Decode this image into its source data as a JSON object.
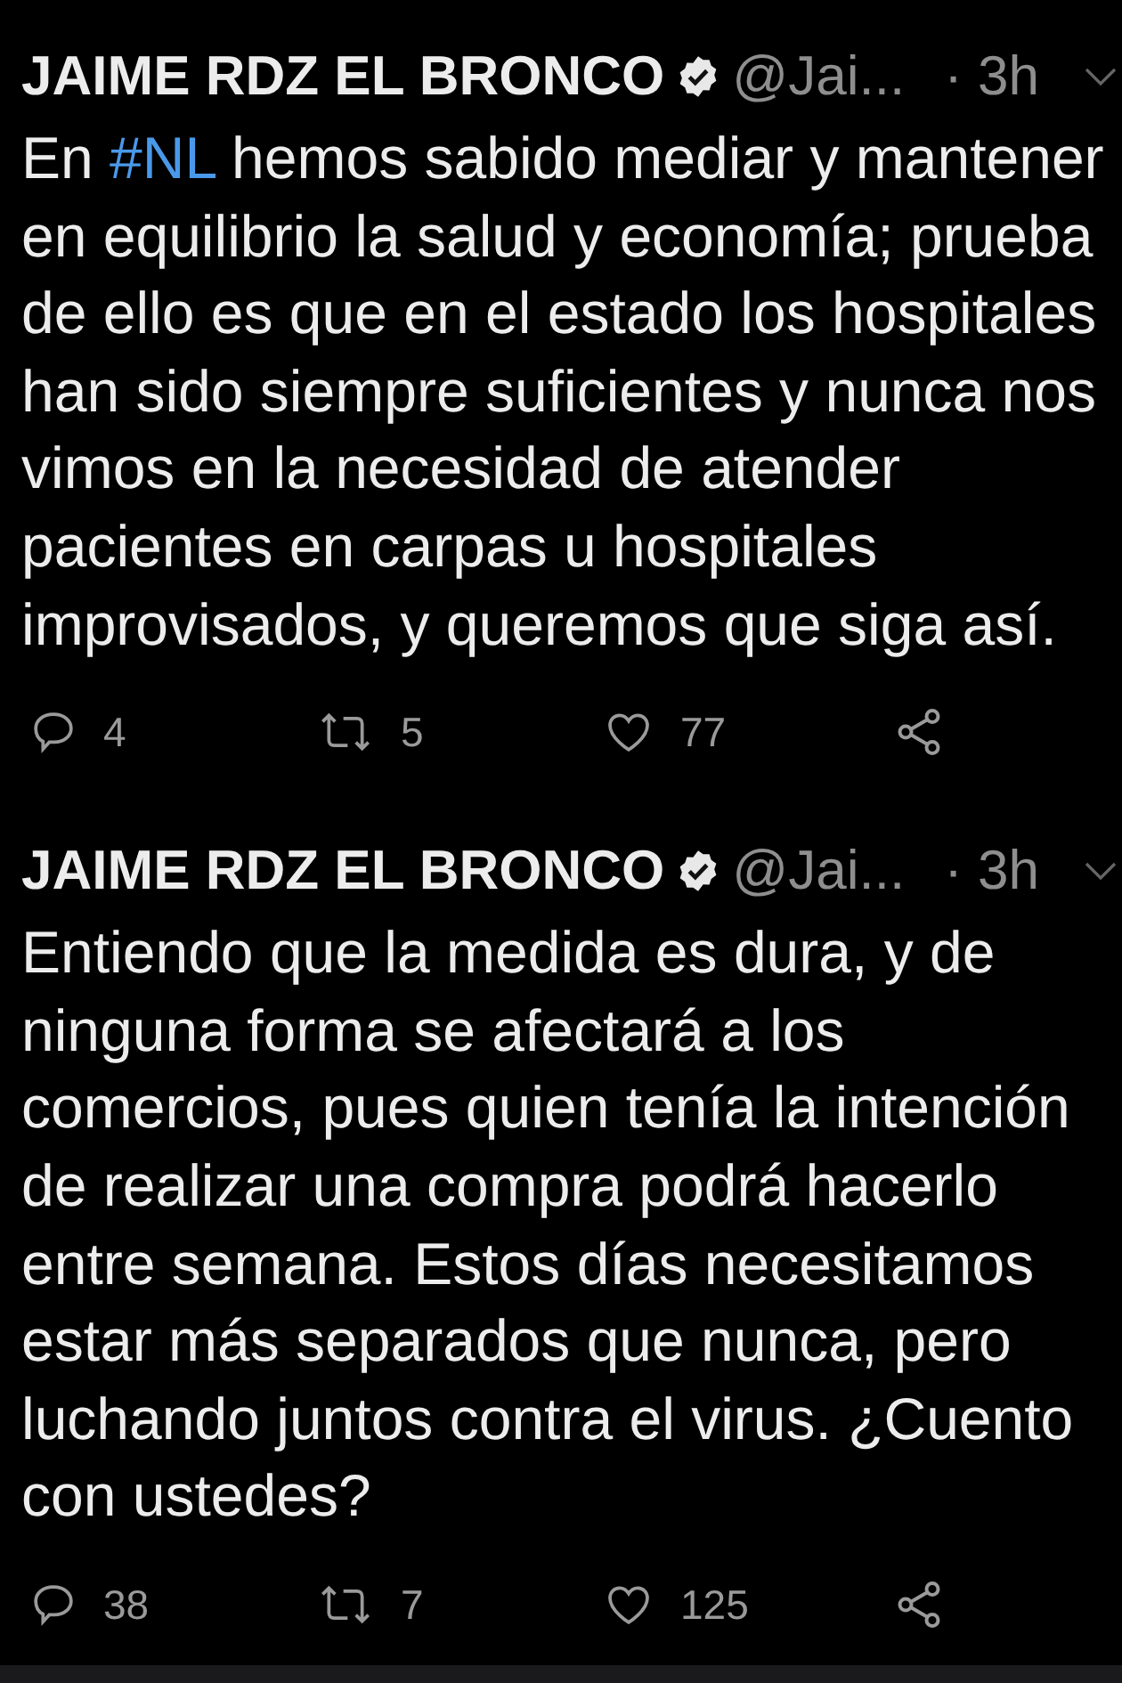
{
  "tweets": [
    {
      "name": "JAIME RDZ EL BRONCO",
      "verified": true,
      "handle": "@Jai...",
      "time": "· 3h",
      "body": [
        {
          "kind": "text",
          "text": "En "
        },
        {
          "kind": "hashtag",
          "text": "#NL"
        },
        {
          "kind": "text",
          "text": " hemos sabido mediar y mantener\nen equilibrio la salud y economía; prueba\nde ello es que en el estado los hospitales\nhan sido siempre suficientes y nunca nos\nvimos en la necesidad de atender\npacientes en carpas u hospitales\nimprovisados, y queremos que siga así."
        }
      ],
      "replies": "4",
      "retweets": "5",
      "likes": "77"
    },
    {
      "name": "JAIME RDZ EL BRONCO",
      "verified": true,
      "handle": "@Jai...",
      "time": "· 3h",
      "body": [
        {
          "kind": "text",
          "text": "Entiendo que la medida es dura, y de\nninguna forma se afectará a los\ncomercios, pues quien tenía la intención\nde realizar una compra podrá hacerlo\nentre semana. Estos días necesitamos\nestar más separados que nunca, pero\nluchando juntos contra el virus. ¿Cuento\ncon ustedes?"
        }
      ],
      "replies": "38",
      "retweets": "7",
      "likes": "125"
    }
  ]
}
